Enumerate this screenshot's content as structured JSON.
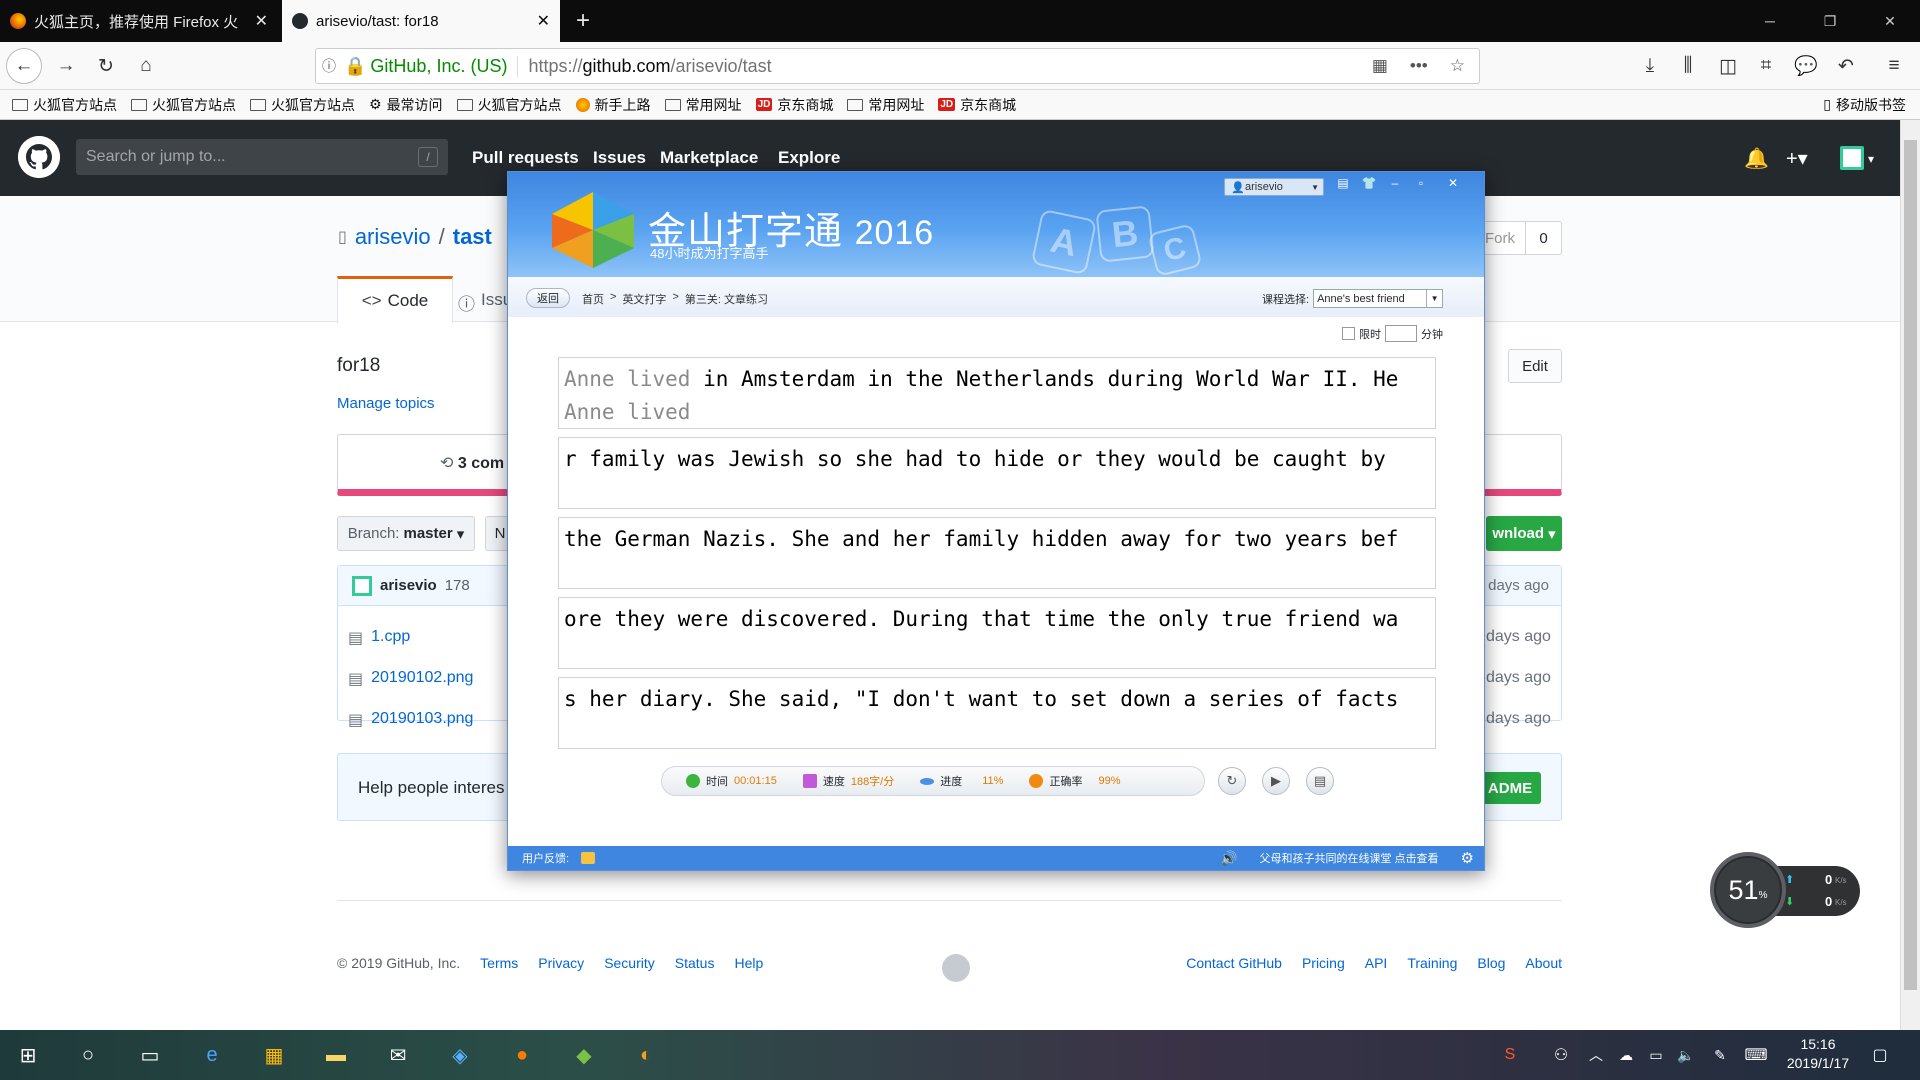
{
  "browser": {
    "tabs": [
      {
        "title": "火狐主页，推荐使用 Firefox 火",
        "close": "✕"
      },
      {
        "title": "arisevio/tast: for18",
        "close": "✕"
      }
    ],
    "new_tab": "+",
    "url_org": "GitHub, Inc. (US)",
    "url_prefix": "https://",
    "url_host": "github.com",
    "url_path": "/arisevio/tast",
    "bookmarks": [
      "火狐官方站点",
      "火狐官方站点",
      "火狐官方站点",
      "最常访问",
      "火狐官方站点",
      "新手上路",
      "常用网址",
      "京东商城",
      "常用网址",
      "京东商城"
    ],
    "mobile_bookmarks": "移动版书签"
  },
  "github": {
    "search_placeholder": "Search or jump to...",
    "search_key": "/",
    "nav": [
      "Pull requests",
      "Issues",
      "Marketplace",
      "Explore"
    ],
    "owner": "arisevio",
    "sep": "/",
    "repo": "tast",
    "fork_label": "Fork",
    "fork_count": "0",
    "tab_code": "Code",
    "tab_issues": "Issu",
    "description": "for18",
    "manage_topics": "Manage topics",
    "edit": "Edit",
    "commits": "3 com",
    "branch_label": "Branch:",
    "branch": "master",
    "new_pr_fragment": "N",
    "download": "wnload",
    "latest_author": "arisevio",
    "latest_msg": "178",
    "latest_time": "days ago",
    "files": [
      {
        "name": "1.cpp",
        "time": "days ago"
      },
      {
        "name": "20190102.png",
        "time": "days ago"
      },
      {
        "name": "20190103.png",
        "time": "days ago"
      }
    ],
    "readme_help": "Help people interes",
    "readme_button": "ADME",
    "footer_left": [
      "© 2019 GitHub, Inc.",
      "Terms",
      "Privacy",
      "Security",
      "Status",
      "Help"
    ],
    "footer_right": [
      "Contact GitHub",
      "Pricing",
      "API",
      "Training",
      "Blog",
      "About"
    ]
  },
  "typing_app": {
    "title": "金山打字通",
    "year": "2016",
    "subtitle": "48小时成为打字高手",
    "user": "arisevio",
    "back": "返回",
    "crumbs": [
      "首页",
      ">",
      "英文打字",
      ">",
      "第三关: 文章练习"
    ],
    "course_label": "课程选择:",
    "course": "Anne's best friend",
    "limit_label": "限时",
    "minutes_label": "分钟",
    "lines": [
      {
        "done": "Anne lived",
        "rest": " in Amsterdam in the Netherlands during World War II. He",
        "typed": "Anne lived"
      },
      {
        "done": "",
        "rest": "r family was Jewish so she had to hide or they would be caught by",
        "typed": ""
      },
      {
        "done": "",
        "rest": "the German Nazis. She and her family hidden away for two years bef",
        "typed": ""
      },
      {
        "done": "",
        "rest": "ore they were discovered. During that time the only true friend wa",
        "typed": ""
      },
      {
        "done": "",
        "rest": "s her diary. She said, \"I don't want to set down a series of facts",
        "typed": ""
      }
    ],
    "stats": {
      "time_label": "时间",
      "time": "00:01:15",
      "speed_label": "速度",
      "speed": "188字/分",
      "progress_label": "进度",
      "progress": "11%",
      "accuracy_label": "正确率",
      "accuracy": "99%"
    },
    "feedback_label": "用户反馈:",
    "footer_link": "父母和孩子共同的在线课堂 点击查看"
  },
  "widget": {
    "percent": "51",
    "unit": "%",
    "up": "0",
    "down": "0",
    "rate_unit": "K/s"
  },
  "taskbar": {
    "time": "15:16",
    "date": "2019/1/17"
  }
}
